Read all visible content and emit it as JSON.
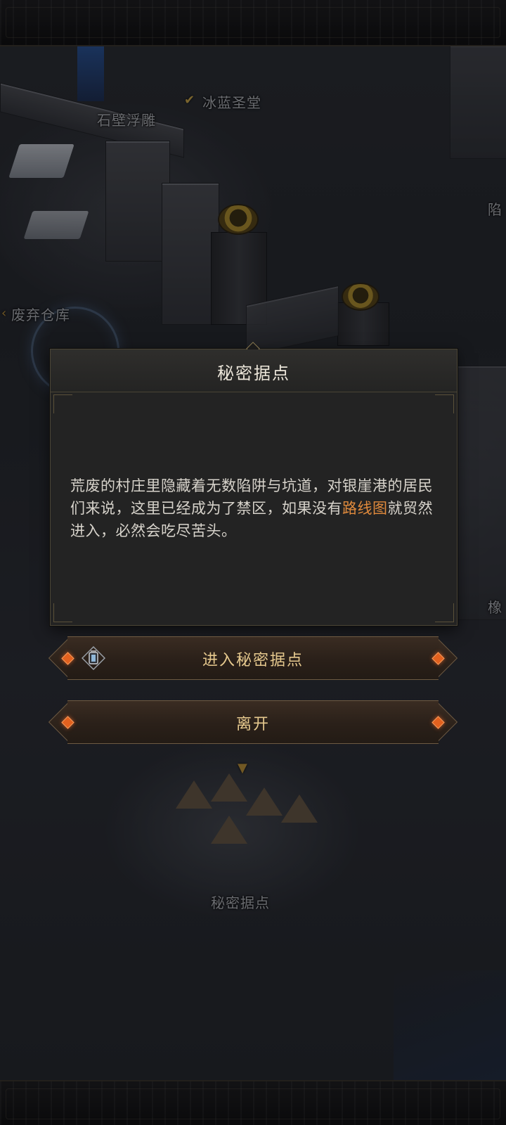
{
  "map": {
    "labels": [
      {
        "text": "冰蓝圣堂",
        "checked": true
      },
      {
        "text": "石壁浮雕"
      },
      {
        "text": "废弃仓库"
      },
      {
        "text": "陷"
      },
      {
        "text": "橡"
      },
      {
        "text": "秘密据点"
      }
    ]
  },
  "dialog": {
    "title": "秘密据点",
    "body_before": "荒废的村庄里隐藏着无数陷阱与坑道，对银崖港的居民们来说，这里已经成为了禁区，如果没有",
    "body_highlight": "路线图",
    "body_after": "就贸然进入，必然会吃尽苦头。",
    "highlight_color": "#e08a3c"
  },
  "buttons": {
    "enter_label": "进入秘密据点",
    "leave_label": "离开",
    "enter_icon": "lantern-icon"
  },
  "colors": {
    "accent": "#e6c98e",
    "gem": "#e2611f"
  }
}
